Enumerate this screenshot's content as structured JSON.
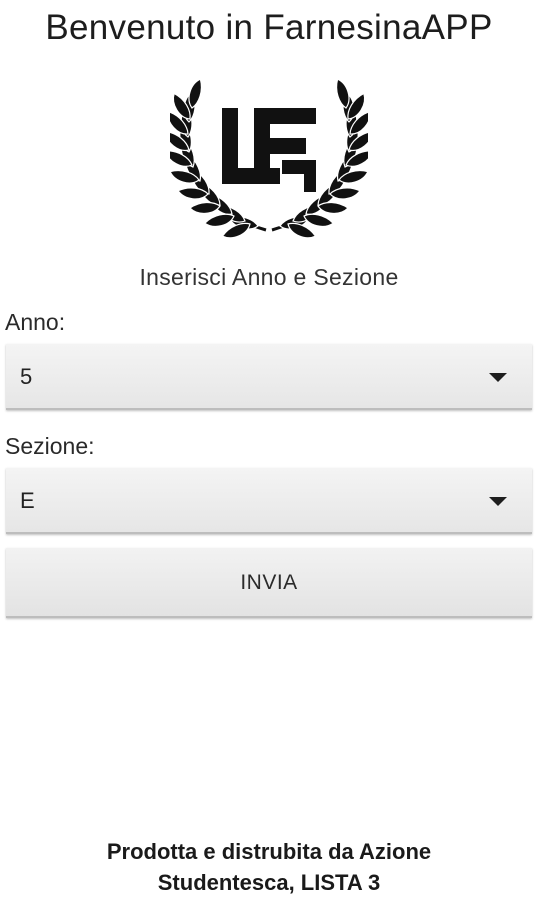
{
  "header": {
    "title": "Benvenuto in FarnesinaAPP"
  },
  "logo": {
    "icon": "laurel-wreath-lf-logo-icon",
    "text": "LF"
  },
  "form": {
    "instruction": "Inserisci Anno e Sezione",
    "anno_label": "Anno:",
    "anno_value": "5",
    "sezione_label": "Sezione:",
    "sezione_value": "E",
    "submit_label": "INVIA"
  },
  "footer": {
    "line1": "Prodotta e distrubita da Azione",
    "line2": "Studentesca, LISTA 3"
  }
}
